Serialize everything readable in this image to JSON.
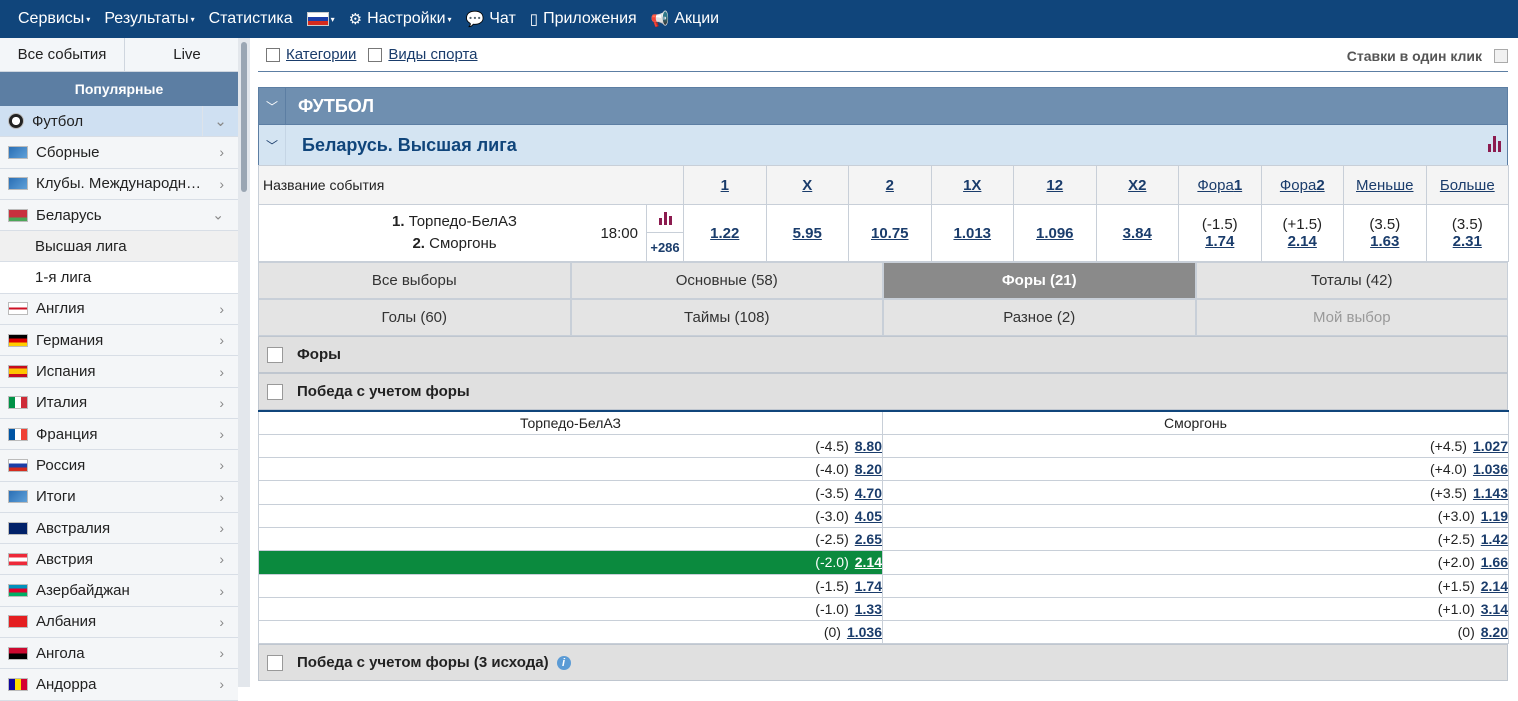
{
  "topnav": {
    "items": [
      {
        "label": "Сервисы",
        "caret": "▾",
        "icon": ""
      },
      {
        "label": "Результаты",
        "caret": "▾",
        "icon": ""
      },
      {
        "label": "Статистика",
        "caret": "",
        "icon": ""
      },
      {
        "label": "",
        "caret": "▾",
        "icon": "flag-ru"
      },
      {
        "label": "Настройки",
        "caret": "▾",
        "icon": "gear-icon"
      },
      {
        "label": "Чат",
        "caret": "",
        "icon": "chat-icon"
      },
      {
        "label": "Приложения",
        "caret": "",
        "icon": "phone-icon"
      },
      {
        "label": "Акции",
        "caret": "",
        "icon": "megaphone-icon"
      }
    ]
  },
  "sidebar": {
    "tabs": [
      "Все события",
      "Live"
    ],
    "popular_label": "Популярные",
    "items": [
      {
        "label": "Футбол",
        "flag": "ball",
        "active": true,
        "expanded": true
      },
      {
        "label": "Сборные",
        "flag": "world"
      },
      {
        "label": "Клубы. Международн…",
        "flag": "world"
      },
      {
        "label": "Беларусь",
        "flag": "by",
        "expanded": true
      },
      {
        "label": "Высшая лига",
        "sub": true
      },
      {
        "label": "1-я лига",
        "sub": true,
        "white": true
      },
      {
        "label": "Англия",
        "flag": "en"
      },
      {
        "label": "Германия",
        "flag": "de"
      },
      {
        "label": "Испания",
        "flag": "es"
      },
      {
        "label": "Италия",
        "flag": "it"
      },
      {
        "label": "Франция",
        "flag": "fr"
      },
      {
        "label": "Россия",
        "flag": "ru"
      },
      {
        "label": "Итоги",
        "flag": "world"
      },
      {
        "label": "Австралия",
        "flag": "au"
      },
      {
        "label": "Австрия",
        "flag": "at"
      },
      {
        "label": "Азербайджан",
        "flag": "az"
      },
      {
        "label": "Албания",
        "flag": "al"
      },
      {
        "label": "Ангола",
        "flag": "ao"
      },
      {
        "label": "Андорра",
        "flag": "ad"
      }
    ]
  },
  "filters": {
    "categories": "Категории",
    "sports": "Виды спорта",
    "one_click": "Ставки в один клик"
  },
  "sport_title": "ФУТБОЛ",
  "league_title": "Беларусь. Высшая лига",
  "table": {
    "event_name_header": "Название события",
    "headers": [
      {
        "label": "1",
        "bold": true
      },
      {
        "label": "X",
        "bold": true
      },
      {
        "label": "2",
        "bold": true
      },
      {
        "label": "1X",
        "bold": true
      },
      {
        "label": "12",
        "bold": true
      },
      {
        "label": "X2",
        "bold": true
      },
      {
        "label": "Фора",
        "suffix": "1"
      },
      {
        "label": "Фора",
        "suffix": "2"
      },
      {
        "label": "Меньше"
      },
      {
        "label": "Больше"
      }
    ],
    "event": {
      "team1_num": "1.",
      "team1": "Торпедо-БелАЗ",
      "team2_num": "2.",
      "team2": "Сморгонь",
      "time": "18:00",
      "more": "+286",
      "odds": [
        "1.22",
        "5.95",
        "10.75",
        "1.013",
        "1.096",
        "3.84"
      ],
      "handicaps": [
        {
          "line": "(-1.5)",
          "odd": "1.74"
        },
        {
          "line": "(+1.5)",
          "odd": "2.14"
        },
        {
          "line": "(3.5)",
          "odd": "1.63"
        },
        {
          "line": "(3.5)",
          "odd": "2.31"
        }
      ]
    }
  },
  "tabs": [
    {
      "label": "Все выборы"
    },
    {
      "label": "Основные (58)"
    },
    {
      "label": "Форы (21)",
      "active": true
    },
    {
      "label": "Тоталы (42)"
    },
    {
      "label": "Голы (60)"
    },
    {
      "label": "Таймы (108)"
    },
    {
      "label": "Разное (2)"
    },
    {
      "label": "Мой выбор",
      "muted": true
    }
  ],
  "sections": {
    "handicaps": "Форы",
    "win_handicap": "Победа с учетом форы",
    "win_handicap3": "Победа с учетом форы (3 исхода)"
  },
  "handicap_table": {
    "team1": "Торпедо-БелАЗ",
    "team2": "Сморгонь",
    "rows": [
      {
        "l_line": "(-4.5)",
        "l_odd": "8.80",
        "r_line": "(+4.5)",
        "r_odd": "1.027"
      },
      {
        "l_line": "(-4.0)",
        "l_odd": "8.20",
        "r_line": "(+4.0)",
        "r_odd": "1.036"
      },
      {
        "l_line": "(-3.5)",
        "l_odd": "4.70",
        "r_line": "(+3.5)",
        "r_odd": "1.143"
      },
      {
        "l_line": "(-3.0)",
        "l_odd": "4.05",
        "r_line": "(+3.0)",
        "r_odd": "1.19"
      },
      {
        "l_line": "(-2.5)",
        "l_odd": "2.65",
        "r_line": "(+2.5)",
        "r_odd": "1.42"
      },
      {
        "l_line": "(-2.0)",
        "l_odd": "2.14",
        "r_line": "(+2.0)",
        "r_odd": "1.66",
        "selected": true
      },
      {
        "l_line": "(-1.5)",
        "l_odd": "1.74",
        "r_line": "(+1.5)",
        "r_odd": "2.14"
      },
      {
        "l_line": "(-1.0)",
        "l_odd": "1.33",
        "r_line": "(+1.0)",
        "r_odd": "3.14"
      },
      {
        "l_line": "(0)",
        "l_odd": "1.036",
        "r_line": "(0)",
        "r_odd": "8.20"
      }
    ]
  },
  "colors": {
    "nav": "#10457b",
    "selected": "#0b8a3e",
    "sport_head": "#6f8fb0",
    "league_head": "#d4e4f2"
  }
}
